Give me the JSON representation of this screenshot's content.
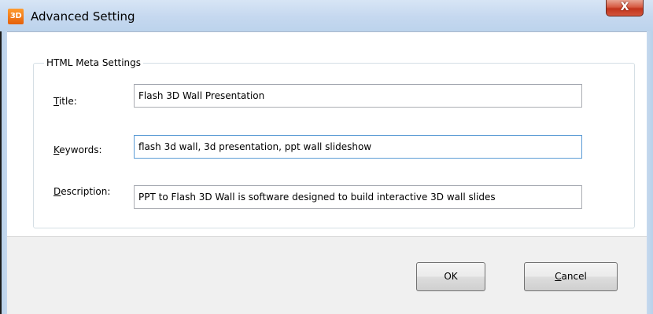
{
  "window": {
    "app_icon_text": "3D",
    "title": "Advanced Setting",
    "close_glyph": "X"
  },
  "group": {
    "legend": "HTML Meta Settings"
  },
  "fields": {
    "title": {
      "label_access_key": "T",
      "label_rest": "itle:",
      "value": "Flash 3D Wall Presentation"
    },
    "keywords": {
      "label_access_key": "K",
      "label_rest": "eywords:",
      "value": "flash 3d wall, 3d presentation, ppt wall slideshow"
    },
    "description": {
      "label_access_key": "D",
      "label_rest": "escription:",
      "value": "PPT to Flash 3D Wall is software designed to build interactive 3D wall slides"
    }
  },
  "buttons": {
    "ok_label": "OK",
    "cancel_access_key": "C",
    "cancel_rest": "ancel"
  },
  "colors": {
    "titlebar": "#c5d8ef",
    "close_button": "#c2341c",
    "app_icon": "#f07a1a",
    "focus_border": "#5b9bd5"
  }
}
